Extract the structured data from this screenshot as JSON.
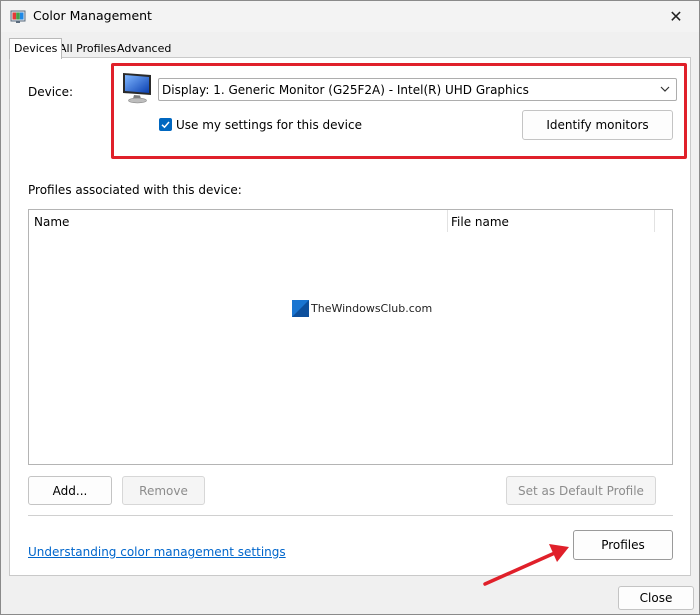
{
  "window": {
    "title": "Color Management",
    "close_glyph": "✕"
  },
  "tabs": [
    {
      "label": "Devices",
      "active": true
    },
    {
      "label": "All Profiles",
      "active": false
    },
    {
      "label": "Advanced",
      "active": false
    }
  ],
  "device": {
    "label": "Device:",
    "selected": "Display: 1. Generic Monitor (G25F2A) - Intel(R) UHD Graphics",
    "use_settings_label": "Use my settings for this device",
    "use_settings_checked": true,
    "identify_label": "Identify monitors"
  },
  "profiles": {
    "section_label": "Profiles associated with this device:",
    "columns": [
      "Name",
      "File name"
    ],
    "rows": []
  },
  "watermark": {
    "text": "TheWindowsClub.com"
  },
  "buttons": {
    "add": "Add...",
    "remove": "Remove",
    "set_default": "Set as Default Profile",
    "profiles": "Profiles",
    "close": "Close"
  },
  "link": {
    "text": "Understanding color management settings"
  },
  "colors": {
    "accent": "#0067c0",
    "highlight_border": "#e0202a",
    "link": "#0066cc",
    "arrow": "#e0202a"
  },
  "icons": {
    "app": "color-management-app-icon",
    "monitor": "monitor-icon",
    "dropdown": "chevron-down-icon",
    "check": "checkmark-icon"
  }
}
